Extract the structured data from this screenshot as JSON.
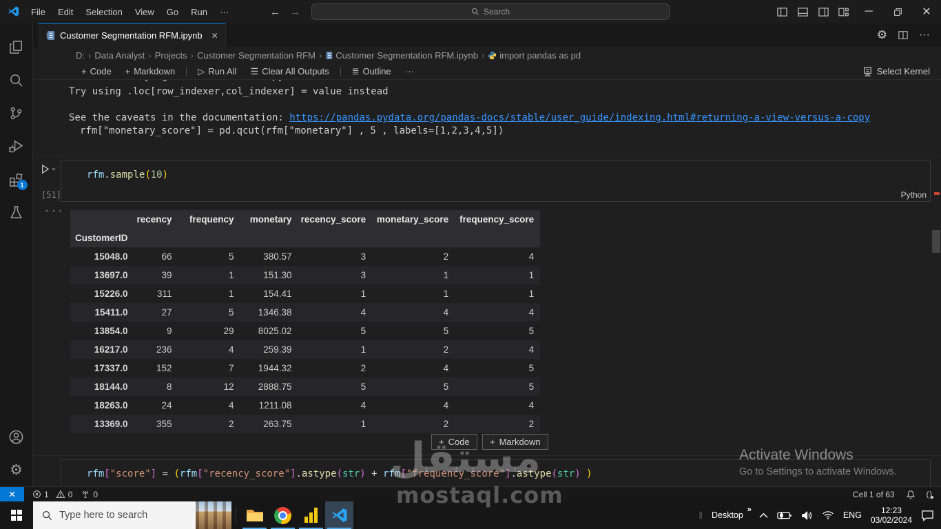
{
  "icons": {
    "plus": "+",
    "more": "···",
    "back": "←",
    "forward": "→",
    "close": "✕",
    "gear": "⚙",
    "chevron": "›",
    "run": "▷",
    "caret": "⌄",
    "clear": "☰",
    "list": "≣",
    "minimize": "─",
    "dots": "...",
    "chevron_up": "^",
    "braces": "( )"
  },
  "titlebar": {
    "menus": [
      "File",
      "Edit",
      "Selection",
      "View",
      "Go",
      "Run"
    ],
    "search_placeholder": "Search"
  },
  "tab": {
    "title": "Customer Segmentation RFM.ipynb"
  },
  "breadcrumb": {
    "drive": "D:",
    "folder1": "Data Analyst",
    "folder2": "Projects",
    "folder3": "Customer Segmentation RFM",
    "file": "Customer Segmentation RFM.ipynb",
    "symbol": "import pandas as pd"
  },
  "nb_toolbar": {
    "code": "Code",
    "markdown": "Markdown",
    "run_all": "Run All",
    "clear_all": "Clear All Outputs",
    "outline": "Outline",
    "select_kernel": "Select Kernel"
  },
  "activitybar": {
    "extensions_badge": "1"
  },
  "warning_output": {
    "clipped_line": "A value is trying to be set on a copy of a slice from a DataFrame",
    "line1": "Try using .loc[row_indexer,col_indexer] = value instead",
    "line2_prefix": "See the caveats in the documentation: ",
    "line2_link": "https://pandas.pydata.org/pandas-docs/stable/user_guide/indexing.html#returning-a-view-versus-a-copy",
    "line3": "rfm[\"monetary_score\"] = pd.qcut(rfm[\"monetary\"] , 5 , labels=[1,2,3,4,5])"
  },
  "cell1": {
    "execution_count": "[51]",
    "language": "Python",
    "tokens": [
      [
        "rfm",
        "var"
      ],
      [
        ".",
        "plain"
      ],
      [
        "sample",
        "fn"
      ],
      [
        "(",
        "b1"
      ],
      [
        "10",
        "num"
      ],
      [
        ")",
        "b1"
      ]
    ]
  },
  "output_table": {
    "index_name": "CustomerID",
    "columns": [
      "recency",
      "frequency",
      "monetary",
      "recency_score",
      "monetary_score",
      "frequency_score"
    ],
    "rows": [
      [
        "15048.0",
        "66",
        "5",
        "380.57",
        "3",
        "2",
        "4"
      ],
      [
        "13697.0",
        "39",
        "1",
        "151.30",
        "3",
        "1",
        "1"
      ],
      [
        "15226.0",
        "311",
        "1",
        "154.41",
        "1",
        "1",
        "1"
      ],
      [
        "15411.0",
        "27",
        "5",
        "1346.38",
        "4",
        "4",
        "4"
      ],
      [
        "13854.0",
        "9",
        "29",
        "8025.02",
        "5",
        "5",
        "5"
      ],
      [
        "16217.0",
        "236",
        "4",
        "259.39",
        "1",
        "2",
        "4"
      ],
      [
        "17337.0",
        "152",
        "7",
        "1944.32",
        "2",
        "4",
        "5"
      ],
      [
        "18144.0",
        "8",
        "12",
        "2888.75",
        "5",
        "5",
        "5"
      ],
      [
        "18263.0",
        "24",
        "4",
        "1211.08",
        "4",
        "4",
        "4"
      ],
      [
        "13369.0",
        "355",
        "2",
        "263.75",
        "1",
        "2",
        "2"
      ]
    ]
  },
  "insert_bar": {
    "code": "Code",
    "markdown": "Markdown"
  },
  "cell2": {
    "tokens": [
      [
        "rfm",
        "var"
      ],
      [
        "[",
        "b2"
      ],
      [
        "\"score\"",
        "str"
      ],
      [
        "]",
        "b2"
      ],
      [
        " = ",
        "plain"
      ],
      [
        "(",
        "b1"
      ],
      [
        "rfm",
        "var"
      ],
      [
        "[",
        "b2"
      ],
      [
        "\"recency_score\"",
        "str"
      ],
      [
        "]",
        "b2"
      ],
      [
        ".",
        "plain"
      ],
      [
        "astype",
        "fn"
      ],
      [
        "(",
        "b2"
      ],
      [
        "str",
        "type"
      ],
      [
        ")",
        "b2"
      ],
      [
        " + ",
        "plain"
      ],
      [
        "rfm",
        "var"
      ],
      [
        "[",
        "b2"
      ],
      [
        "\"frequency_score\"",
        "str"
      ],
      [
        "]",
        "b2"
      ],
      [
        ".",
        "plain"
      ],
      [
        "astype",
        "fn"
      ],
      [
        "(",
        "b2"
      ],
      [
        "str",
        "type"
      ],
      [
        ")",
        "b2"
      ],
      [
        " )",
        "b1"
      ]
    ]
  },
  "activate": {
    "line1": "Activate Windows",
    "line2": "Go to Settings to activate Windows."
  },
  "statusbar": {
    "errors": "1",
    "warnings": "0",
    "ports": "0",
    "cell_indicator": "Cell 1 of 63"
  },
  "taskbar": {
    "search_placeholder": "Type here to search",
    "desktop_label": "Desktop",
    "overflow_chevrons": "»",
    "lang": "ENG",
    "time": "12:23",
    "date": "03/02/2024"
  },
  "watermark": {
    "arabic": "مستقل",
    "latin": "mostaql.com"
  },
  "colors": {
    "accent": "#0078d4",
    "link": "#3794ff"
  }
}
